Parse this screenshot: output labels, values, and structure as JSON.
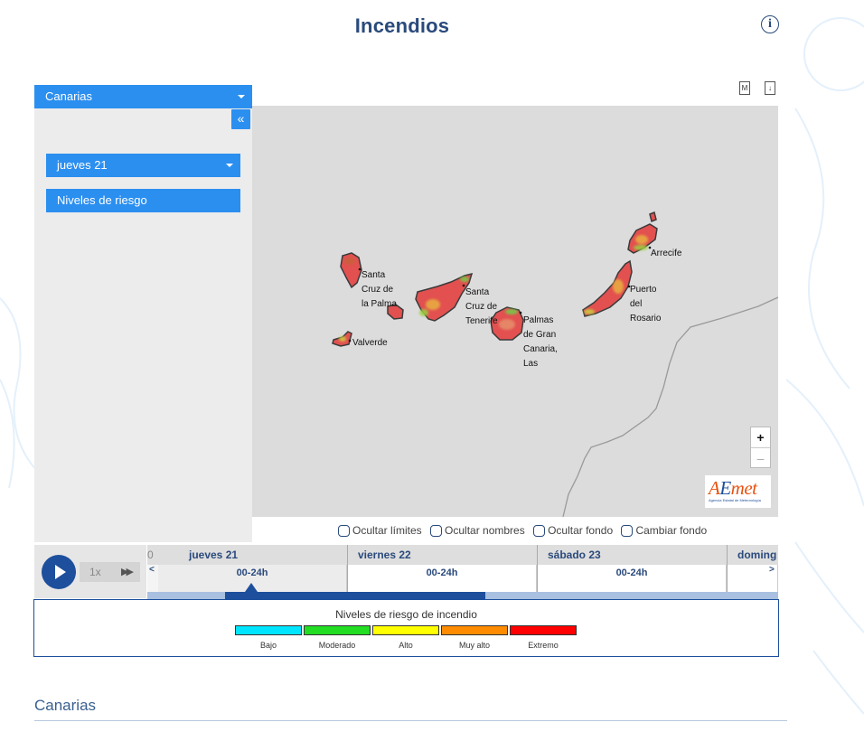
{
  "page": {
    "title": "Incendios"
  },
  "sidebar": {
    "region_select": "Canarias",
    "collapse_label": "«",
    "day_select": "jueves 21",
    "layer_button": "Niveles de riesgo"
  },
  "map": {
    "cities": [
      {
        "name": "Santa\nCruz de\nla Palma"
      },
      {
        "name": "Valverde"
      },
      {
        "name": "Santa\nCruz de\nTenerife"
      },
      {
        "name": "Palmas\nde Gran\nCanaria,\nLas"
      },
      {
        "name": "Arrecife"
      },
      {
        "name": "Puerto\ndel\nRosario"
      }
    ],
    "zoom_in": "+",
    "zoom_out": "–",
    "logo": {
      "word_a": "A",
      "word_e": "E",
      "word_rest": "met",
      "subtitle": "Agencia Estatal de Meteorología"
    },
    "doc_icons": [
      {
        "icon": "document-m-icon",
        "glyph": "M"
      },
      {
        "icon": "download-icon",
        "glyph": "↓"
      }
    ]
  },
  "options": [
    {
      "label": "Ocultar límites"
    },
    {
      "label": "Ocultar nombres"
    },
    {
      "label": "Ocultar fondo"
    },
    {
      "label": "Cambiar fondo"
    }
  ],
  "player": {
    "speed": "1x",
    "ff": "▶▶"
  },
  "timeline": {
    "prev": "<",
    "next": ">",
    "partial_left": "0",
    "days": [
      {
        "label": "jueves 21",
        "hour": "00-24h"
      },
      {
        "label": "viernes 22",
        "hour": "00-24h"
      },
      {
        "label": "sábado 23",
        "hour": "00-24h"
      },
      {
        "label": "doming",
        "hour": ""
      }
    ]
  },
  "legend": {
    "title": "Niveles de riesgo de incendio",
    "items": [
      {
        "label": "Bajo",
        "color": "#00e5ff"
      },
      {
        "label": "Moderado",
        "color": "#22dd22"
      },
      {
        "label": "Alto",
        "color": "#ffff00"
      },
      {
        "label": "Muy alto",
        "color": "#ff8c00"
      },
      {
        "label": "Extremo",
        "color": "#ff0000"
      }
    ]
  },
  "footer": {
    "section_title": "Canarias"
  }
}
